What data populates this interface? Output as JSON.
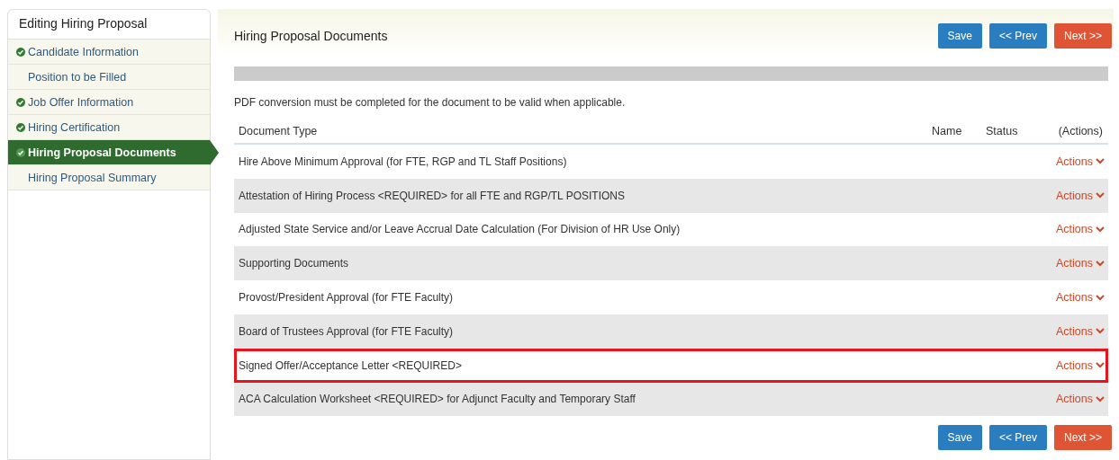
{
  "sidebar": {
    "title": "Editing Hiring Proposal",
    "items": [
      {
        "label": "Candidate Information",
        "complete": true,
        "selected": false
      },
      {
        "label": "Position to be Filled",
        "complete": false,
        "selected": false
      },
      {
        "label": "Job Offer Information",
        "complete": true,
        "selected": false
      },
      {
        "label": "Hiring Certification",
        "complete": true,
        "selected": false
      },
      {
        "label": "Hiring Proposal Documents",
        "complete": true,
        "selected": true
      },
      {
        "label": "Hiring Proposal Summary",
        "complete": false,
        "selected": false
      }
    ]
  },
  "main": {
    "title": "Hiring Proposal Documents",
    "buttons": [
      {
        "label": "Save",
        "kind": "save"
      },
      {
        "label": "<< Prev",
        "kind": "prev"
      },
      {
        "label": "Next >>",
        "kind": "next"
      }
    ],
    "note": "PDF conversion must be completed for the document to be valid when applicable.",
    "table": {
      "columns": [
        "Document Type",
        "Name",
        "Status",
        "(Actions)"
      ],
      "rows": [
        {
          "document_type": "Hire Above Minimum Approval (for FTE, RGP and TL Staff Positions)",
          "actions": "Actions",
          "highlighted": false
        },
        {
          "document_type": "Attestation of Hiring Process <REQUIRED> for all FTE and RGP/TL POSITIONS",
          "actions": "Actions",
          "highlighted": false
        },
        {
          "document_type": "Adjusted State Service and/or Leave Accrual Date Calculation (For Division of HR Use Only)",
          "actions": "Actions",
          "highlighted": false
        },
        {
          "document_type": "Supporting Documents",
          "actions": "Actions",
          "highlighted": false
        },
        {
          "document_type": "Provost/President Approval (for FTE Faculty)",
          "actions": "Actions",
          "highlighted": false
        },
        {
          "document_type": "Board of Trustees Approval (for FTE Faculty)",
          "actions": "Actions",
          "highlighted": false
        },
        {
          "document_type": "Signed Offer/Acceptance Letter <REQUIRED>",
          "actions": "Actions",
          "highlighted": true
        },
        {
          "document_type": "ACA Calculation Worksheet <REQUIRED> for Adjunct Faculty and Temporary Staff",
          "actions": "Actions",
          "highlighted": false
        }
      ]
    },
    "bottom_buttons": [
      {
        "label": "Save",
        "kind": "save"
      },
      {
        "label": "<< Prev",
        "kind": "prev"
      },
      {
        "label": "Next >>",
        "kind": "next"
      }
    ]
  }
}
